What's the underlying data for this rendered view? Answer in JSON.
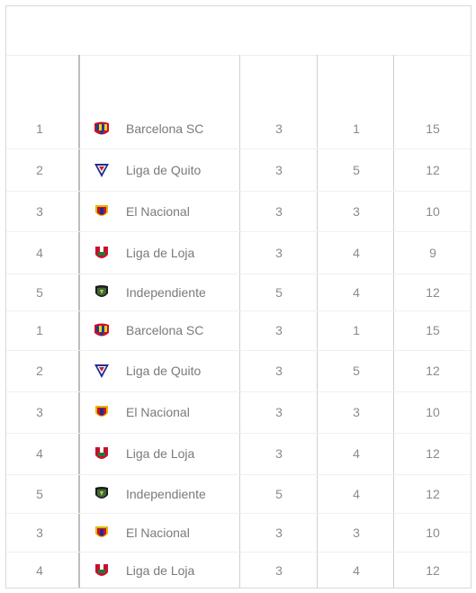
{
  "rows": [
    {
      "rank": "1",
      "team": "Barcelona SC",
      "logo": "barcelona-sc-crest-icon",
      "p": "3",
      "w": "1",
      "pts": "15"
    },
    {
      "rank": "2",
      "team": "Liga de Quito",
      "logo": "liga-de-quito-crest-icon",
      "p": "3",
      "w": "5",
      "pts": "12"
    },
    {
      "rank": "3",
      "team": "El Nacional",
      "logo": "el-nacional-crest-icon",
      "p": "3",
      "w": "3",
      "pts": "10"
    },
    {
      "rank": "4",
      "team": "Liga de Loja",
      "logo": "liga-de-loja-crest-icon",
      "p": "3",
      "w": "4",
      "pts": "9"
    },
    {
      "rank": "5",
      "team": "Independiente",
      "logo": "independiente-crest-icon",
      "p": "5",
      "w": "4",
      "pts": "12"
    },
    {
      "rank": "1",
      "team": "Barcelona SC",
      "logo": "barcelona-sc-crest-icon",
      "p": "3",
      "w": "1",
      "pts": "15"
    },
    {
      "rank": "2",
      "team": "Liga de Quito",
      "logo": "liga-de-quito-crest-icon",
      "p": "3",
      "w": "5",
      "pts": "12"
    },
    {
      "rank": "3",
      "team": "El Nacional",
      "logo": "el-nacional-crest-icon",
      "p": "3",
      "w": "3",
      "pts": "10"
    },
    {
      "rank": "4",
      "team": "Liga de Loja",
      "logo": "liga-de-loja-crest-icon",
      "p": "3",
      "w": "4",
      "pts": "12"
    },
    {
      "rank": "5",
      "team": "Independiente",
      "logo": "independiente-crest-icon",
      "p": "5",
      "w": "4",
      "pts": "12"
    },
    {
      "rank": "3",
      "team": "El Nacional",
      "logo": "el-nacional-crest-icon",
      "p": "3",
      "w": "3",
      "pts": "10"
    },
    {
      "rank": "4",
      "team": "Liga de Loja",
      "logo": "liga-de-loja-crest-icon",
      "p": "3",
      "w": "4",
      "pts": "12"
    }
  ]
}
